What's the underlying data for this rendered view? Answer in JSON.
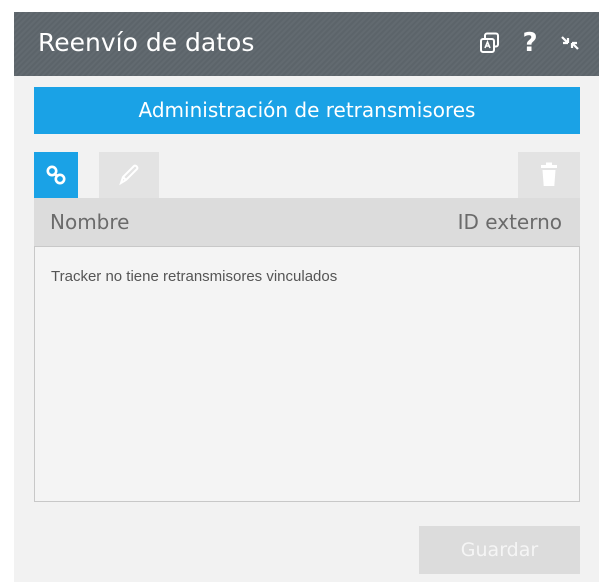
{
  "window": {
    "title": "Reenvío de datos",
    "icons": [
      "copy-icon",
      "help-icon",
      "minimize-icon"
    ],
    "help_glyph": "?"
  },
  "banner": {
    "label": "Administración de retransmisores"
  },
  "toolbar": {
    "tabs": [
      {
        "icon": "link-icon",
        "active": true
      },
      {
        "icon": "edit-icon",
        "active": false
      }
    ],
    "delete_icon": "trash-icon"
  },
  "table": {
    "columns": [
      "Nombre",
      "ID externo"
    ],
    "empty_message": "Tracker no tiene retransmisores vinculados"
  },
  "footer": {
    "save_label": "Guardar"
  },
  "colors": {
    "titlebar": "#5c646a",
    "accent": "#1aa2e6",
    "panel": "#f2f2f2",
    "header": "#dcdcdc"
  }
}
